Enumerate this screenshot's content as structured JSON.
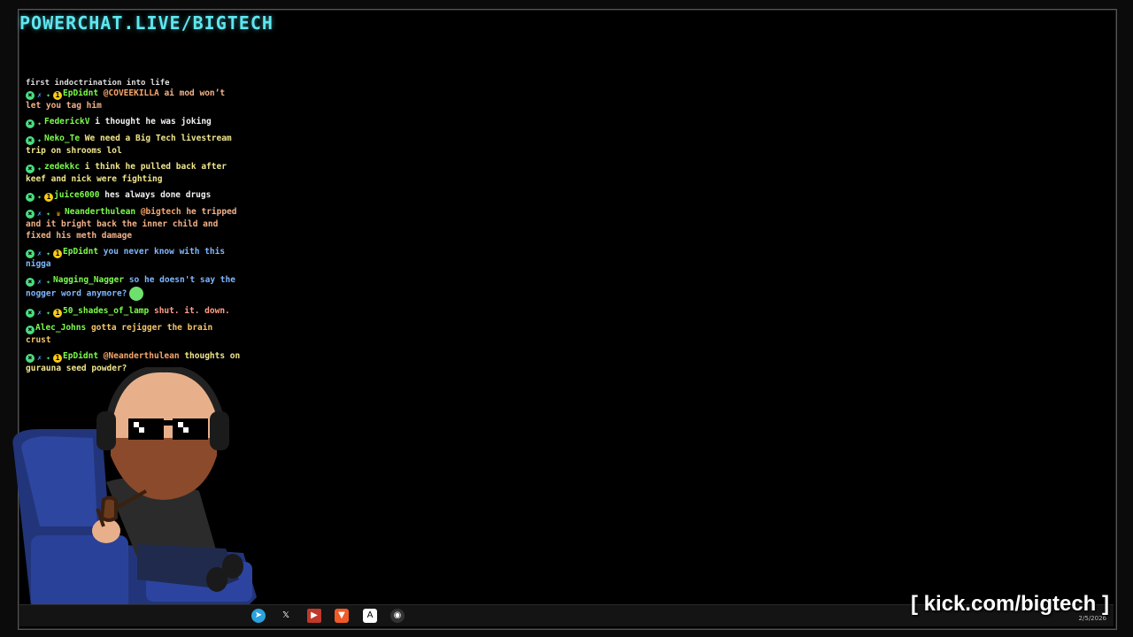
{
  "brand": "POWERCHAT.LIVE/BIGTECH",
  "chat": {
    "cut_line": "first indoctrination into life",
    "messages": [
      {
        "user": "EpDidnt",
        "badges": [
          "mod",
          "sword",
          "gem",
          "sub"
        ],
        "mention": "@COVEEKILLA",
        "text": "ai mod won’t let you tag him",
        "style": "txt-b"
      },
      {
        "user": "FederickV",
        "badges": [
          "mod",
          "gem"
        ],
        "mention": "",
        "text": "i thought he was joking",
        "style": "txt-a"
      },
      {
        "user": "Neko_Te",
        "badges": [
          "mod",
          "gem"
        ],
        "mention": "",
        "text": "We need a Big Tech livestream trip on shrooms lol",
        "style": "txt-c"
      },
      {
        "user": "zedekkc",
        "badges": [
          "mod",
          "gem"
        ],
        "mention": "",
        "text": "i think he pulled back after keef and nick were fighting",
        "style": "txt-c"
      },
      {
        "user": "juice6000",
        "badges": [
          "mod",
          "gem",
          "sub"
        ],
        "mention": "",
        "text": "hes always done drugs",
        "style": "txt-a"
      },
      {
        "user": "Neanderthulean",
        "badges": [
          "mod",
          "sword",
          "gem",
          "crown"
        ],
        "mention": "@bigtech",
        "text": "he tripped and it bright back the inner child and fixed his meth damage",
        "style": "txt-b"
      },
      {
        "user": "EpDidnt",
        "badges": [
          "mod",
          "sword",
          "gem",
          "sub"
        ],
        "mention": "",
        "text": "you never know with this nigga",
        "style": "txt-d"
      },
      {
        "user": "Nagging_Nagger",
        "badges": [
          "mod",
          "sword",
          "gem"
        ],
        "mention": "",
        "text": "so he doesn't say the nogger word anymore?",
        "style": "txt-d",
        "emote": true
      },
      {
        "user": "50_shades_of_lamp",
        "badges": [
          "mod",
          "sword",
          "gem",
          "sub"
        ],
        "mention": "",
        "text": "shut. it. down.",
        "style": "txt-f"
      },
      {
        "user": "Alec_Johns",
        "badges": [
          "mod"
        ],
        "mention": "",
        "text": "gotta rejigger the brain crust",
        "style": "txt-e"
      },
      {
        "user": "EpDidnt",
        "badges": [
          "mod",
          "sword",
          "gem",
          "sub"
        ],
        "mention": "@Neanderthulean",
        "text": "thoughts on gurauna seed powder?",
        "style": "txt-c"
      }
    ]
  },
  "taskbar": {
    "icons": [
      "telegram-icon",
      "x-icon",
      "video-editor-icon",
      "brave-icon",
      "ai-app-icon",
      "obs-icon"
    ],
    "date": "2/5/2026"
  },
  "overlay": {
    "kick": "[ kick.com/bigtech ]"
  },
  "colors": {
    "brand": "#5ee7f0",
    "username": "#7cfc4c"
  }
}
